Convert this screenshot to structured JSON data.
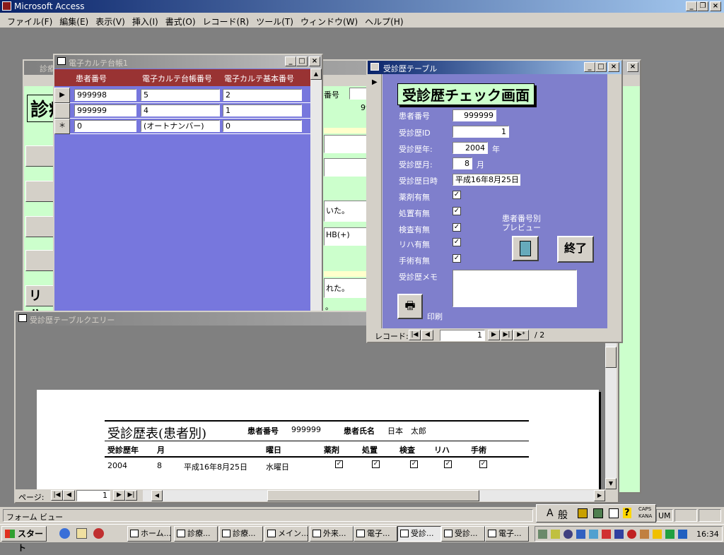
{
  "app": {
    "title": "Microsoft Access"
  },
  "menu": [
    "ファイル(F)",
    "編集(E)",
    "表示(V)",
    "挿入(I)",
    "書式(O)",
    "レコード(R)",
    "ツール(T)",
    "ウィンドウ(W)",
    "ヘルプ(H)"
  ],
  "bg_form": {
    "title": "診療",
    "heading": "診療",
    "partial_texts": [
      "番号",
      "99",
      "いた。",
      "HB(+)",
      "れた。",
      "。"
    ],
    "btn_label": "リハ"
  },
  "table_window": {
    "title": "電子カルテ台帳1",
    "columns": [
      "患者番号",
      "電子カルテ台帳番号",
      "電子カルテ基本番号"
    ],
    "rows": [
      {
        "marker": "▶",
        "cells": [
          "999998",
          "5",
          "2"
        ]
      },
      {
        "marker": "",
        "cells": [
          "999999",
          "4",
          "1"
        ]
      },
      {
        "marker": "＊",
        "cells": [
          "0",
          "(オートナンバー)",
          "0"
        ]
      }
    ]
  },
  "form_window": {
    "title": "受診歴テーブル",
    "heading": "受診歴チェック画面",
    "fields": {
      "patient_no": {
        "label": "患者番号",
        "value": "999999"
      },
      "visit_id": {
        "label": "受診歴ID",
        "value": "1"
      },
      "year": {
        "label": "受診歴年:",
        "value": "2004",
        "unit": "年"
      },
      "month": {
        "label": "受診歴月:",
        "value": "8",
        "unit": "月"
      },
      "datetime": {
        "label": "受診歴日時",
        "value": "平成16年8月25日"
      }
    },
    "checks": [
      {
        "label": "薬剤有無",
        "checked": true
      },
      {
        "label": "処置有無",
        "checked": true
      },
      {
        "label": "検査有無",
        "checked": true
      },
      {
        "label": "リハ有無",
        "checked": true
      },
      {
        "label": "手術有無",
        "checked": true
      }
    ],
    "memo_label": "受診歴メモ",
    "preview_label_1": "患者番号別",
    "preview_label_2": "プレビュー",
    "end_button": "終了",
    "print_label": "印刷",
    "nav": {
      "label": "レコード:",
      "current": "1",
      "total": "/ 2"
    }
  },
  "report_window": {
    "title": "受診歴テーブルクエリー",
    "report_title": "受診歴表(患者別)",
    "patient_no_label": "患者番号",
    "patient_no": "999999",
    "patient_name_label": "患者氏名",
    "patient_name": "日本　太郎",
    "headers": [
      "受診歴年",
      "月",
      "曜日",
      "薬剤",
      "処置",
      "検査",
      "リハ",
      "手術"
    ],
    "row": {
      "year": "2004",
      "month": "8",
      "date": "平成16年8月25日",
      "weekday": "水曜日"
    },
    "page_label": "ページ:",
    "page_current": "1"
  },
  "status": {
    "text": "フォーム ビュー",
    "num": "UM"
  },
  "ime": {
    "mode_a": "A",
    "mode_b": "般",
    "caps": "CAPS",
    "kana": "KANA"
  },
  "taskbar": {
    "start": "スタート",
    "buttons": [
      "ホーム...",
      "診療...",
      "診療...",
      "メイン...",
      "外来...",
      "電子...",
      "受診...",
      "受診...",
      "電子..."
    ],
    "clock": "16:34"
  }
}
